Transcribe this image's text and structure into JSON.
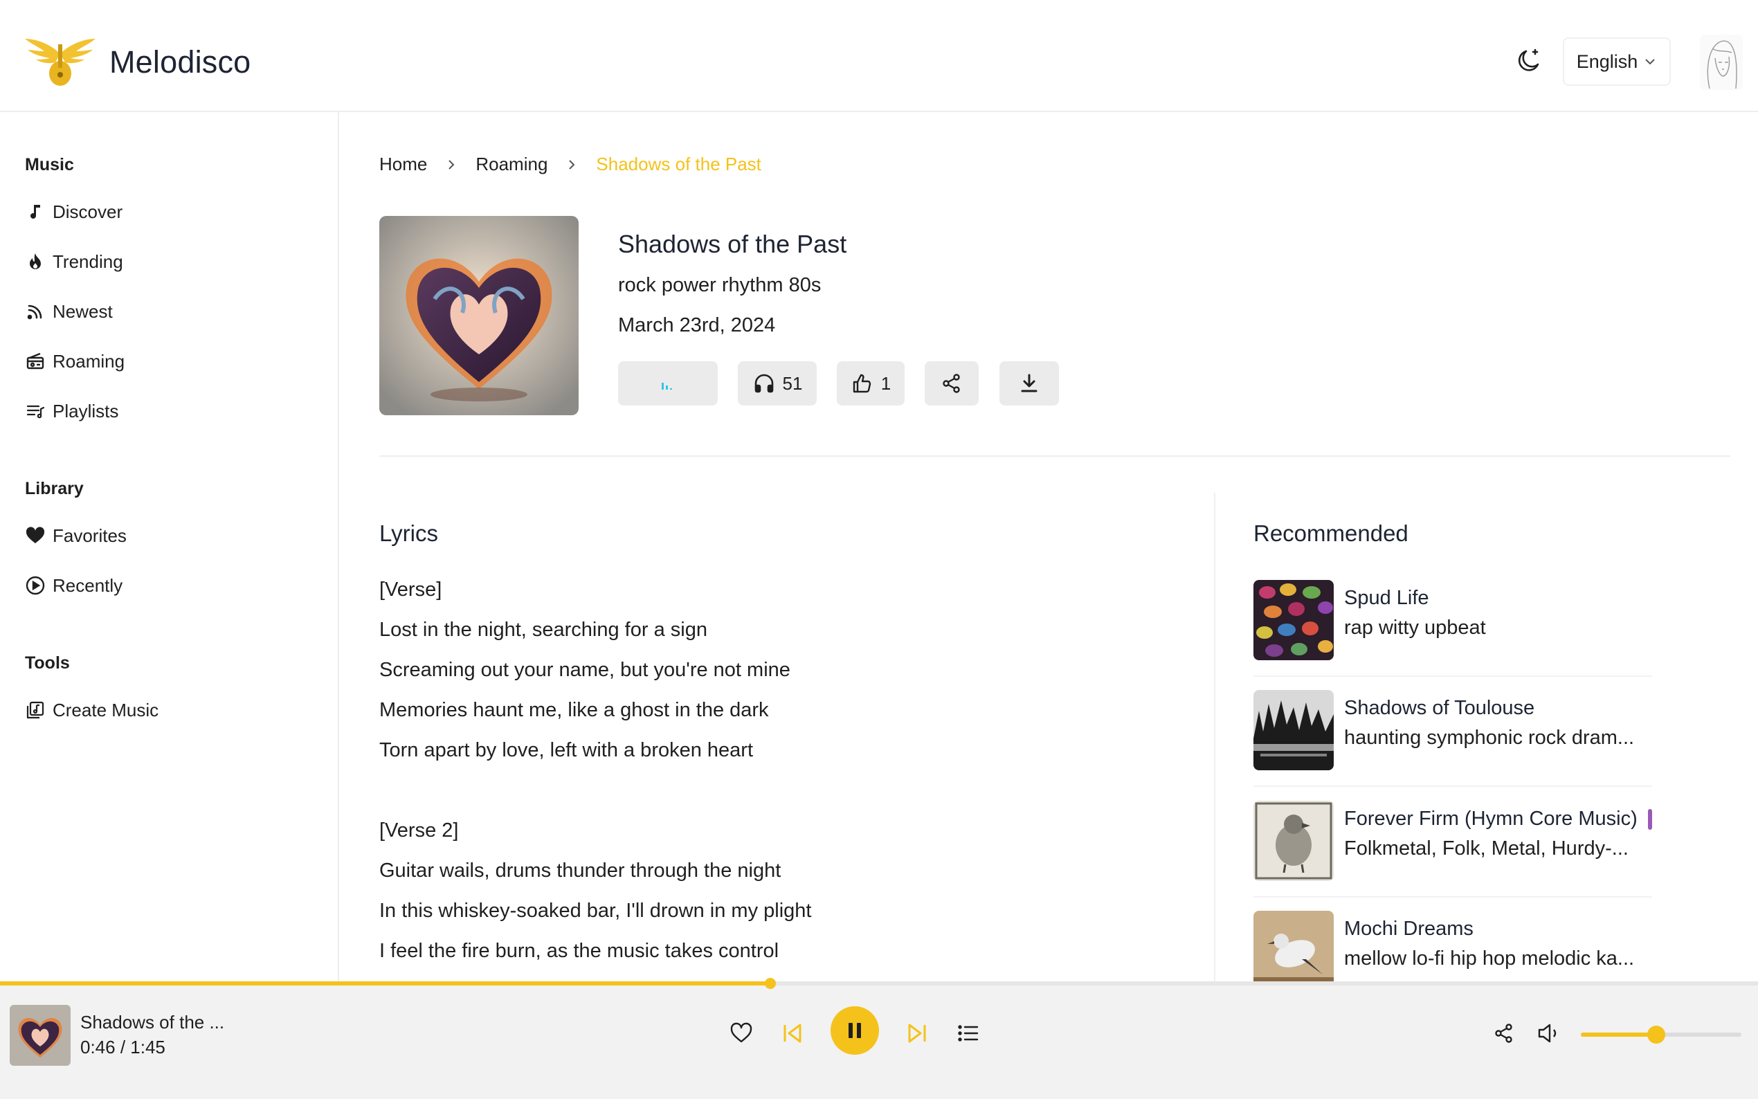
{
  "header": {
    "brand": "Melodisco",
    "language": "English"
  },
  "sidebar": {
    "sections": [
      {
        "title": "Music",
        "items": [
          {
            "label": "Discover",
            "icon": "music-note-icon"
          },
          {
            "label": "Trending",
            "icon": "flame-icon"
          },
          {
            "label": "Newest",
            "icon": "rss-icon"
          },
          {
            "label": "Roaming",
            "icon": "radio-icon"
          },
          {
            "label": "Playlists",
            "icon": "playlist-icon"
          }
        ]
      },
      {
        "title": "Library",
        "items": [
          {
            "label": "Favorites",
            "icon": "heart-icon"
          },
          {
            "label": "Recently",
            "icon": "play-circle-icon"
          }
        ]
      },
      {
        "title": "Tools",
        "items": [
          {
            "label": "Create Music",
            "icon": "create-music-icon"
          }
        ]
      }
    ]
  },
  "breadcrumb": [
    "Home",
    "Roaming",
    "Shadows of the Past"
  ],
  "song": {
    "title": "Shadows of the Past",
    "tags": "rock power rhythm 80s",
    "date": "March 23rd, 2024",
    "plays": "51",
    "likes": "1"
  },
  "lyrics": {
    "title": "Lyrics",
    "lines": [
      "[Verse]",
      "Lost in the night, searching for a sign",
      "Screaming out your name, but you're not mine",
      "Memories haunt me, like a ghost in the dark",
      "Torn apart by love, left with a broken heart",
      "",
      "[Verse 2]",
      "Guitar wails, drums thunder through the night",
      "In this whiskey-soaked bar, I'll drown in my plight",
      "I feel the fire burn, as the music takes control"
    ]
  },
  "recommended": {
    "title": "Recommended",
    "items": [
      {
        "title": "Spud Life",
        "subtitle": "rap witty upbeat"
      },
      {
        "title": "Shadows of Toulouse",
        "subtitle": "haunting symphonic rock dram..."
      },
      {
        "title": "Forever Firm (Hymn Core Music)",
        "subtitle": "Folkmetal, Folk, Metal, Hurdy-..."
      },
      {
        "title": "Mochi Dreams",
        "subtitle": "mellow lo-fi hip hop melodic ka..."
      }
    ]
  },
  "player": {
    "title": "Shadows of the ...",
    "time": "0:46 / 1:45",
    "progress": 0.438,
    "volume": 0.47
  },
  "colors": {
    "accent": "#f4c21b",
    "equalizer": "#2ec9e6",
    "text": "#1f1f1f"
  }
}
